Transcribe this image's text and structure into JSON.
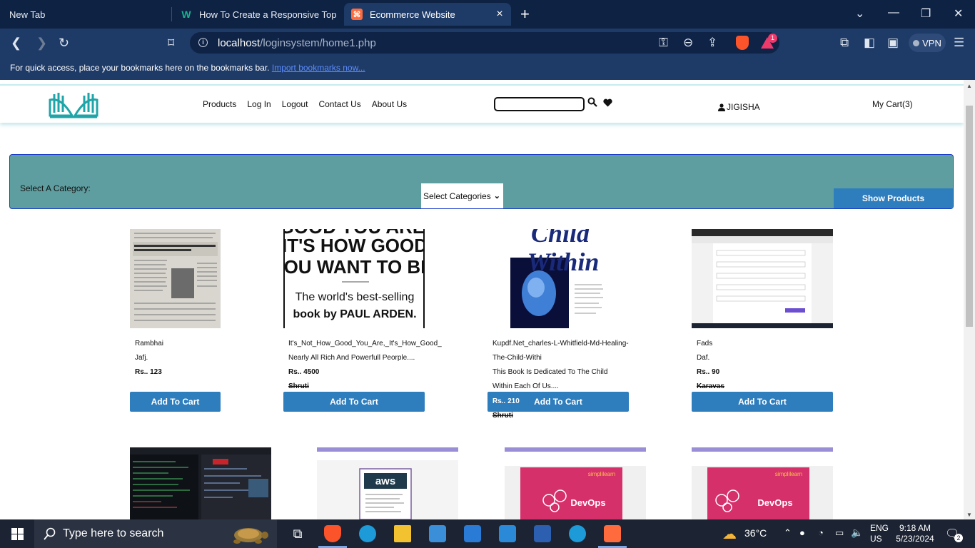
{
  "browser": {
    "tabs": [
      {
        "title": "New Tab",
        "favicon": "none"
      },
      {
        "title": "How To Create a Responsive Top Nav",
        "favicon": "w3schools-icon"
      },
      {
        "title": "Ecommerce Website",
        "favicon": "ecommerce-icon",
        "active": true
      }
    ],
    "url_host": "localhost",
    "url_path": "/loginsystem/home1.php",
    "bookmarks_prompt": "For quick access, place your bookmarks here on the bookmarks bar.",
    "bookmarks_link": "Import bookmarks now...",
    "notification_count": "1",
    "vpn_label": "VPN"
  },
  "site": {
    "nav": [
      "Products",
      "Log In",
      "Logout",
      "Contact Us",
      "About Us"
    ],
    "search_value": "",
    "username": "JIGISHA",
    "cart_label": "My Cart(3)",
    "category_label": "Select A Category:",
    "category_select": "Select Categories",
    "show_products": "Show Products"
  },
  "products": [
    {
      "name": "Rambhai",
      "desc": "Jafj.",
      "price": "Rs.. 123",
      "seller": "",
      "button": "Add To Cart"
    },
    {
      "name": "It's_Not_How_Good_You_Are,_It's_How_Good_",
      "desc": "Nearly All Rich And Powerfull Peorple....",
      "price": "Rs.. 4500",
      "seller": "Shruti",
      "button": "Add To Cart",
      "cover_lines": [
        "GOOD YOU ARE,",
        "IT'S HOW GOOD",
        "YOU WANT TO BE.",
        "The world's best-selling",
        "book by PAUL ARDEN."
      ]
    },
    {
      "name": "Kupdf.Net_charles-L-Whitfield-Md-Healing-",
      "name2": "The-Child-Withi",
      "desc": "This Book Is Dedicated To The Child",
      "desc2": "Within Each Of Us....",
      "price": "Rs.. 210",
      "seller": "Shruti",
      "button": "Add To Cart",
      "cover_lines": [
        "Child",
        "Within"
      ]
    },
    {
      "name": "Fads",
      "desc": "Daf.",
      "price": "Rs.. 90",
      "seller": "Karavas",
      "button": "Add To Cart"
    }
  ],
  "products_row2": [
    {
      "cover": "terminal-screenshot"
    },
    {
      "cover": "aws-screenshot",
      "label": "aws"
    },
    {
      "cover": "devops-screenshot",
      "label": "DevOps",
      "brand": "simplilearn"
    },
    {
      "cover": "devops-screenshot",
      "label": "DevOps",
      "brand": "simplilearn"
    }
  ],
  "taskbar": {
    "search_placeholder": "Type here to search",
    "weather": "36°C",
    "lang_top": "ENG",
    "lang_bottom": "US",
    "time": "9:18 AM",
    "date": "5/23/2024",
    "notifications": "2"
  },
  "colors": {
    "chrome_dark": "#0e2244",
    "chrome": "#1e3a66",
    "category_bg": "#5f9ea0",
    "button_blue": "#2e7dbd",
    "logo_teal": "#1fa5a8"
  }
}
